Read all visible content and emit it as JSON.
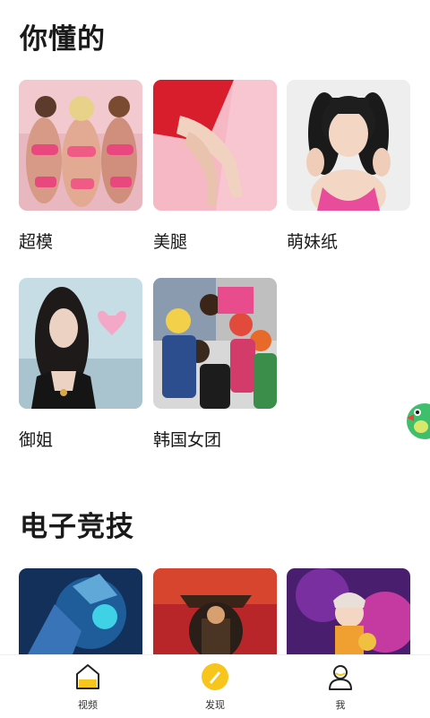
{
  "sections": {
    "beauty": {
      "title": "你懂的",
      "items": [
        {
          "label": "超模"
        },
        {
          "label": "美腿"
        },
        {
          "label": "萌妹纸"
        },
        {
          "label": "御姐"
        },
        {
          "label": "韩国女团"
        }
      ]
    },
    "esports": {
      "title": "电子竞技"
    }
  },
  "tabbar": {
    "items": [
      {
        "label": "视频",
        "icon": "home-icon"
      },
      {
        "label": "发现",
        "icon": "discover-icon"
      },
      {
        "label": "我",
        "icon": "profile-icon"
      }
    ],
    "active_color": "#f7c51c"
  }
}
